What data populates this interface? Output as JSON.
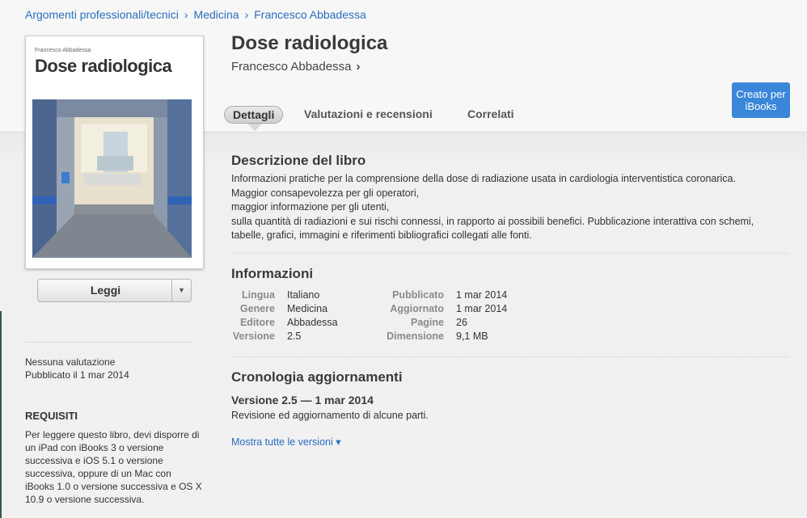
{
  "breadcrumb": {
    "items": [
      "Argomenti professionali/tecnici",
      "Medicina",
      "Francesco Abbadessa"
    ]
  },
  "book": {
    "title": "Dose radiologica",
    "author": "Francesco Abbadessa",
    "cover_author": "Francesco Abbadessa",
    "cover_title": "Dose radiologica"
  },
  "actions": {
    "read_label": "Leggi",
    "badge_line1": "Creato per",
    "badge_line2": "iBooks"
  },
  "tabs": [
    {
      "label": "Dettagli",
      "active": true
    },
    {
      "label": "Valutazioni e recensioni",
      "active": false
    },
    {
      "label": "Correlati",
      "active": false
    }
  ],
  "sidebar": {
    "rating": "Nessuna valutazione",
    "published": "Pubblicato il 1 mar 2014",
    "requirements_title": "REQUISITI",
    "requirements_lines": [
      "Per leggere questo libro, devi disporre di",
      "un iPad con iBooks 3 o versione",
      "successiva e iOS 5.1 o versione",
      "successiva, oppure di un Mac con",
      "iBooks 1.0 o versione successiva e OS X",
      "10.9 o versione successiva."
    ]
  },
  "description": {
    "title": "Descrizione del libro",
    "lines": [
      "Informazioni pratiche per la comprensione della dose di radiazione usata in cardiologia interventistica coronarica.",
      "Maggior consapevolezza per gli operatori,",
      "maggior informazione per gli utenti,",
      "sulla quantità di radiazioni e sui rischi connessi, in rapporto ai possibili benefici. Pubblicazione interattiva con schemi,",
      "tabelle, grafici, immagini e riferimenti bibliografici collegati alle fonti."
    ]
  },
  "info": {
    "title": "Informazioni",
    "left": [
      {
        "label": "Lingua",
        "value": "Italiano"
      },
      {
        "label": "Genere",
        "value": "Medicina"
      },
      {
        "label": "Editore",
        "value": "Abbadessa"
      },
      {
        "label": "Versione",
        "value": "2.5"
      }
    ],
    "right": [
      {
        "label": "Pubblicato",
        "value": "1 mar 2014"
      },
      {
        "label": "Aggiornato",
        "value": "1 mar 2014"
      },
      {
        "label": "Pagine",
        "value": "26"
      },
      {
        "label": "Dimensione",
        "value": "9,1 MB"
      }
    ]
  },
  "history": {
    "title": "Cronologia aggiornamenti",
    "version_heading": "Versione 2.5 — 1 mar 2014",
    "version_note": "Revisione ed aggiornamento di alcune parti.",
    "show_all": "Mostra tutte le versioni ▾"
  },
  "colors": {
    "link": "#2a6ebd",
    "badge": "#3a87d9"
  }
}
